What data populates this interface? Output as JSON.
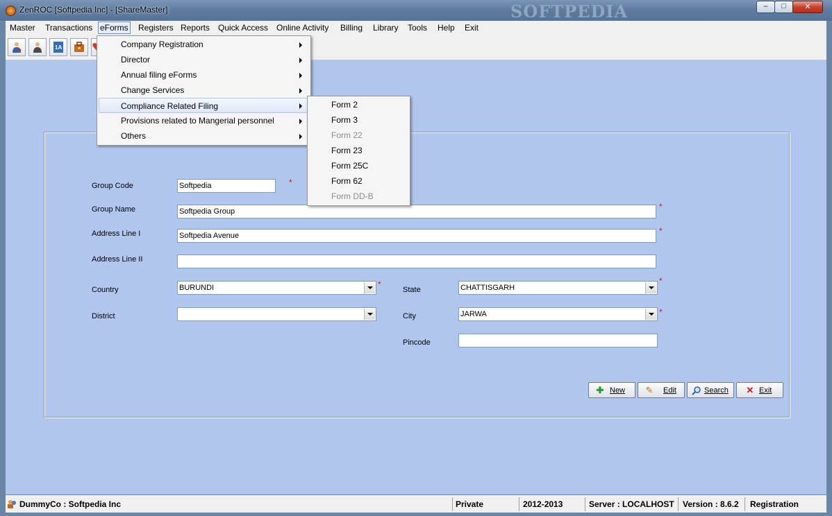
{
  "window": {
    "title": "ZenROC [Softpedia Inc] - [ShareMaster]",
    "watermark": "SOFTPEDIA",
    "minimize": "–",
    "maximize": "□",
    "close": "✕"
  },
  "menubar": [
    "Master",
    "Transactions",
    "eForms",
    "Registers",
    "Reports",
    "Quick Access",
    "Online Activity",
    "Billing",
    "Library",
    "Tools",
    "Help",
    "Exit"
  ],
  "toolbar": {
    "icons": [
      "user-edit-icon",
      "manager-icon",
      "form-1a-icon",
      "briefcase-icon",
      "heart-icon"
    ],
    "form_badge": "1A"
  },
  "eforms_menu": {
    "items": [
      "Company Registration",
      "Director",
      "Annual filing eForms",
      "Change Services",
      "Compliance Related Filing",
      "Provisions related to Mangerial personnel",
      "Others"
    ],
    "highlighted": "Compliance Related Filing"
  },
  "compliance_submenu": {
    "items": [
      "Form 2",
      "Form 3",
      "Form 22",
      "Form 23",
      "Form 25C",
      "Form 62",
      "Form DD-B"
    ],
    "disabled": [
      "Form 22",
      "Form DD-B"
    ]
  },
  "form": {
    "group_code_label": "Group Code",
    "group_code_value": "Softpedia",
    "group_name_label": "Group Name",
    "group_name_value": "Softpedia Group",
    "address1_label": "Address Line I",
    "address1_value": "Softpedia Avenue",
    "address2_label": "Address Line II",
    "address2_value": "",
    "country_label": "Country",
    "country_value": "BURUNDI",
    "state_label": "State",
    "state_value": "CHATTISGARH",
    "district_label": "District",
    "district_value": "",
    "city_label": "City",
    "city_value": "JARWA",
    "pincode_label": "Pincode",
    "pincode_value": "",
    "required_mark": "*"
  },
  "buttons": {
    "new": "New",
    "edit": "Edit",
    "search": "Search",
    "exit": "Exit"
  },
  "statusbar": {
    "company": "DummyCo : Softpedia Inc",
    "mode": "Private",
    "year": "2012-2013",
    "server": "Server : LOCALHOST",
    "version": "Version : 8.6.2",
    "status": "Registration"
  },
  "colors": {
    "client_bg": "#b1c6ee",
    "required": "#e0101a",
    "titlebar": "#5f7c9f"
  }
}
